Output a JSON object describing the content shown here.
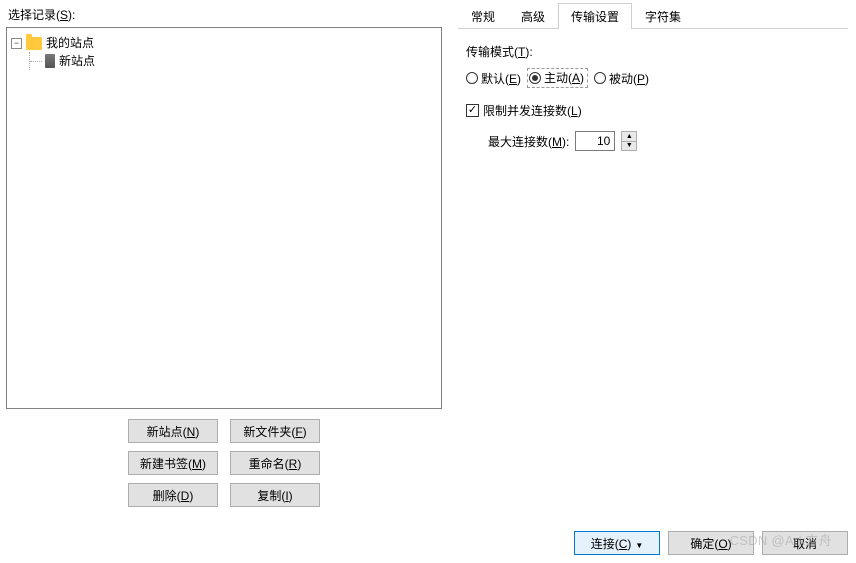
{
  "left": {
    "label": "选择记录(S):",
    "root": "我的站点",
    "child": "新站点",
    "buttons": {
      "newSite": "新站点(N)",
      "newFolder": "新文件夹(F)",
      "newBookmark": "新建书签(M)",
      "rename": "重命名(R)",
      "delete": "删除(D)",
      "copy": "复制(I)"
    }
  },
  "tabs": {
    "general": "常规",
    "advanced": "高级",
    "transfer": "传输设置",
    "charset": "字符集"
  },
  "transfer": {
    "modeLabel": "传输模式(T):",
    "radios": {
      "defaultOpt": "默认(E)",
      "active": "主动(A)",
      "passive": "被动(P)"
    },
    "limitLabel": "限制并发连接数(L)",
    "maxConnLabel": "最大连接数(M):",
    "maxConnValue": "10"
  },
  "footer": {
    "connect": "连接(C)",
    "ok": "确定(O)",
    "cancel": "取消"
  },
  "watermark": "CSDN @Ark方舟"
}
